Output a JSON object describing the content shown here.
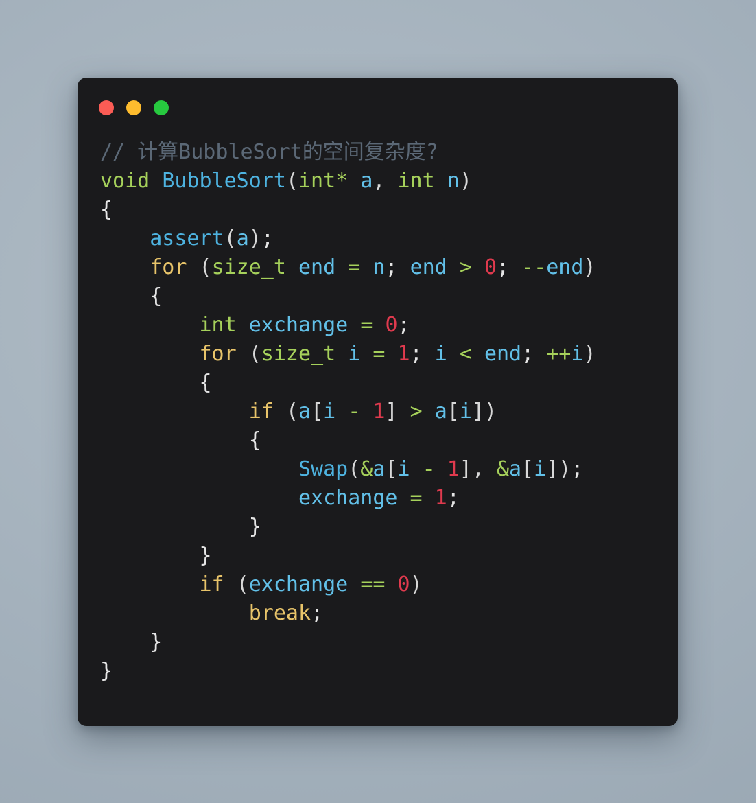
{
  "window": {
    "background_color": "#1a1a1c",
    "page_background_color": "#a6b3be",
    "traffic_lights": [
      {
        "name": "close",
        "color": "#fb5c55"
      },
      {
        "name": "minimize",
        "color": "#febc2e"
      },
      {
        "name": "maximize",
        "color": "#27c93f"
      }
    ]
  },
  "theme": {
    "comment": "#5b6876",
    "type": "#a6d15b",
    "keyword": "#e8c46a",
    "function": "#4eb3e0",
    "variable": "#62c0e8",
    "number": "#e03a4e",
    "operator": "#a6d15b",
    "punctuation": "#d8d8d8",
    "plain": "#e6e6e6"
  },
  "code": {
    "language": "c",
    "plain_text": "// 计算BubbleSort的空间复杂度?\nvoid BubbleSort(int* a, int n)\n{\n    assert(a);\n    for (size_t end = n; end > 0; --end)\n    {\n        int exchange = 0;\n        for (size_t i = 1; i < end; ++i)\n        {\n            if (a[i - 1] > a[i])\n            {\n                Swap(&a[i - 1], &a[i]);\n                exchange = 1;\n            }\n        }\n        if (exchange == 0)\n            break;\n    }\n}",
    "lines": [
      {
        "tokens": [
          {
            "t": "// 计算BubbleSort的空间复杂度?",
            "c": "comment"
          }
        ]
      },
      {
        "tokens": [
          {
            "t": "void",
            "c": "type"
          },
          {
            "t": " ",
            "c": "plain"
          },
          {
            "t": "BubbleSort",
            "c": "func"
          },
          {
            "t": "(",
            "c": "punct"
          },
          {
            "t": "int",
            "c": "type"
          },
          {
            "t": "*",
            "c": "op"
          },
          {
            "t": " ",
            "c": "plain"
          },
          {
            "t": "a",
            "c": "var"
          },
          {
            "t": ", ",
            "c": "punct"
          },
          {
            "t": "int",
            "c": "type"
          },
          {
            "t": " ",
            "c": "plain"
          },
          {
            "t": "n",
            "c": "var"
          },
          {
            "t": ")",
            "c": "punct"
          }
        ]
      },
      {
        "tokens": [
          {
            "t": "{",
            "c": "plain"
          }
        ]
      },
      {
        "tokens": [
          {
            "t": "    ",
            "c": "plain"
          },
          {
            "t": "assert",
            "c": "func"
          },
          {
            "t": "(",
            "c": "punct"
          },
          {
            "t": "a",
            "c": "var"
          },
          {
            "t": ")",
            "c": "punct"
          },
          {
            "t": ";",
            "c": "plain"
          }
        ]
      },
      {
        "tokens": [
          {
            "t": "    ",
            "c": "plain"
          },
          {
            "t": "for",
            "c": "keyword"
          },
          {
            "t": " ",
            "c": "plain"
          },
          {
            "t": "(",
            "c": "punct"
          },
          {
            "t": "size_t",
            "c": "type"
          },
          {
            "t": " ",
            "c": "plain"
          },
          {
            "t": "end",
            "c": "var"
          },
          {
            "t": " ",
            "c": "plain"
          },
          {
            "t": "=",
            "c": "op"
          },
          {
            "t": " ",
            "c": "plain"
          },
          {
            "t": "n",
            "c": "var"
          },
          {
            "t": "; ",
            "c": "plain"
          },
          {
            "t": "end",
            "c": "var"
          },
          {
            "t": " ",
            "c": "plain"
          },
          {
            "t": ">",
            "c": "op"
          },
          {
            "t": " ",
            "c": "plain"
          },
          {
            "t": "0",
            "c": "num"
          },
          {
            "t": "; ",
            "c": "plain"
          },
          {
            "t": "--",
            "c": "op"
          },
          {
            "t": "end",
            "c": "var"
          },
          {
            "t": ")",
            "c": "punct"
          }
        ]
      },
      {
        "tokens": [
          {
            "t": "    {",
            "c": "plain"
          }
        ]
      },
      {
        "tokens": [
          {
            "t": "        ",
            "c": "plain"
          },
          {
            "t": "int",
            "c": "type"
          },
          {
            "t": " ",
            "c": "plain"
          },
          {
            "t": "exchange",
            "c": "var"
          },
          {
            "t": " ",
            "c": "plain"
          },
          {
            "t": "=",
            "c": "op"
          },
          {
            "t": " ",
            "c": "plain"
          },
          {
            "t": "0",
            "c": "num"
          },
          {
            "t": ";",
            "c": "plain"
          }
        ]
      },
      {
        "tokens": [
          {
            "t": "        ",
            "c": "plain"
          },
          {
            "t": "for",
            "c": "keyword"
          },
          {
            "t": " ",
            "c": "plain"
          },
          {
            "t": "(",
            "c": "punct"
          },
          {
            "t": "size_t",
            "c": "type"
          },
          {
            "t": " ",
            "c": "plain"
          },
          {
            "t": "i",
            "c": "var"
          },
          {
            "t": " ",
            "c": "plain"
          },
          {
            "t": "=",
            "c": "op"
          },
          {
            "t": " ",
            "c": "plain"
          },
          {
            "t": "1",
            "c": "num"
          },
          {
            "t": "; ",
            "c": "plain"
          },
          {
            "t": "i",
            "c": "var"
          },
          {
            "t": " ",
            "c": "plain"
          },
          {
            "t": "<",
            "c": "op"
          },
          {
            "t": " ",
            "c": "plain"
          },
          {
            "t": "end",
            "c": "var"
          },
          {
            "t": "; ",
            "c": "plain"
          },
          {
            "t": "++",
            "c": "op"
          },
          {
            "t": "i",
            "c": "var"
          },
          {
            "t": ")",
            "c": "punct"
          }
        ]
      },
      {
        "tokens": [
          {
            "t": "        {",
            "c": "plain"
          }
        ]
      },
      {
        "tokens": [
          {
            "t": "            ",
            "c": "plain"
          },
          {
            "t": "if",
            "c": "keyword"
          },
          {
            "t": " ",
            "c": "plain"
          },
          {
            "t": "(",
            "c": "punct"
          },
          {
            "t": "a",
            "c": "var"
          },
          {
            "t": "[",
            "c": "punct"
          },
          {
            "t": "i",
            "c": "var"
          },
          {
            "t": " ",
            "c": "plain"
          },
          {
            "t": "-",
            "c": "op"
          },
          {
            "t": " ",
            "c": "plain"
          },
          {
            "t": "1",
            "c": "num"
          },
          {
            "t": "]",
            "c": "punct"
          },
          {
            "t": " ",
            "c": "plain"
          },
          {
            "t": ">",
            "c": "op"
          },
          {
            "t": " ",
            "c": "plain"
          },
          {
            "t": "a",
            "c": "var"
          },
          {
            "t": "[",
            "c": "punct"
          },
          {
            "t": "i",
            "c": "var"
          },
          {
            "t": "]",
            "c": "punct"
          },
          {
            "t": ")",
            "c": "punct"
          }
        ]
      },
      {
        "tokens": [
          {
            "t": "            {",
            "c": "plain"
          }
        ]
      },
      {
        "tokens": [
          {
            "t": "                ",
            "c": "plain"
          },
          {
            "t": "Swap",
            "c": "func"
          },
          {
            "t": "(",
            "c": "punct"
          },
          {
            "t": "&",
            "c": "op"
          },
          {
            "t": "a",
            "c": "var"
          },
          {
            "t": "[",
            "c": "punct"
          },
          {
            "t": "i",
            "c": "var"
          },
          {
            "t": " ",
            "c": "plain"
          },
          {
            "t": "-",
            "c": "op"
          },
          {
            "t": " ",
            "c": "plain"
          },
          {
            "t": "1",
            "c": "num"
          },
          {
            "t": "]",
            "c": "punct"
          },
          {
            "t": ", ",
            "c": "punct"
          },
          {
            "t": "&",
            "c": "op"
          },
          {
            "t": "a",
            "c": "var"
          },
          {
            "t": "[",
            "c": "punct"
          },
          {
            "t": "i",
            "c": "var"
          },
          {
            "t": "]",
            "c": "punct"
          },
          {
            "t": ")",
            "c": "punct"
          },
          {
            "t": ";",
            "c": "plain"
          }
        ]
      },
      {
        "tokens": [
          {
            "t": "                ",
            "c": "plain"
          },
          {
            "t": "exchange",
            "c": "var"
          },
          {
            "t": " ",
            "c": "plain"
          },
          {
            "t": "=",
            "c": "op"
          },
          {
            "t": " ",
            "c": "plain"
          },
          {
            "t": "1",
            "c": "num"
          },
          {
            "t": ";",
            "c": "plain"
          }
        ]
      },
      {
        "tokens": [
          {
            "t": "            }",
            "c": "plain"
          }
        ]
      },
      {
        "tokens": [
          {
            "t": "        }",
            "c": "plain"
          }
        ]
      },
      {
        "tokens": [
          {
            "t": "        ",
            "c": "plain"
          },
          {
            "t": "if",
            "c": "keyword"
          },
          {
            "t": " ",
            "c": "plain"
          },
          {
            "t": "(",
            "c": "punct"
          },
          {
            "t": "exchange",
            "c": "var"
          },
          {
            "t": " ",
            "c": "plain"
          },
          {
            "t": "==",
            "c": "op"
          },
          {
            "t": " ",
            "c": "plain"
          },
          {
            "t": "0",
            "c": "num"
          },
          {
            "t": ")",
            "c": "punct"
          }
        ]
      },
      {
        "tokens": [
          {
            "t": "            ",
            "c": "plain"
          },
          {
            "t": "break",
            "c": "keyword"
          },
          {
            "t": ";",
            "c": "plain"
          }
        ]
      },
      {
        "tokens": [
          {
            "t": "    }",
            "c": "plain"
          }
        ]
      },
      {
        "tokens": [
          {
            "t": "}",
            "c": "plain"
          }
        ]
      }
    ]
  }
}
